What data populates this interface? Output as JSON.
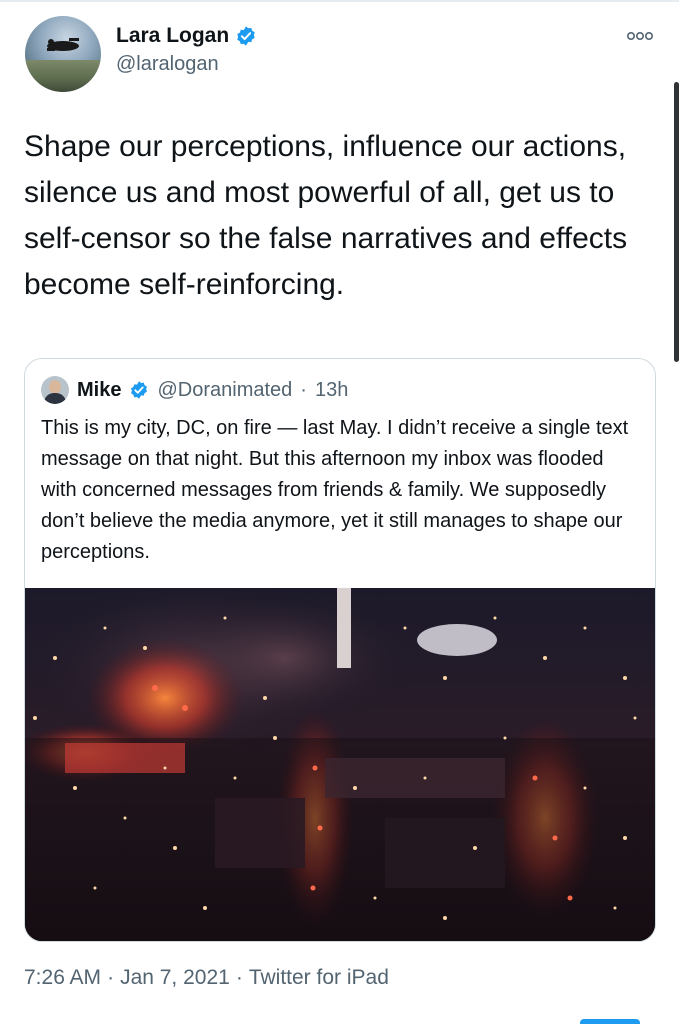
{
  "tweet": {
    "author": {
      "display_name": "Lara Logan",
      "handle": "@laralogan",
      "verified_icon": "verified-badge-icon",
      "avatar_icon": "skydiver-avatar"
    },
    "more_icon": "more-options-icon",
    "text": "Shape our perceptions, influence our actions, silence us and most powerful of all, get us to self-censor so the false narratives and effects become self-reinforcing.",
    "quoted": {
      "display_name": "Mike",
      "handle": "@Doranimated",
      "separator": "·",
      "time": "13h",
      "text": "This is my city, DC, on fire — last May. I didn’t receive a single text message on that night. But this afternoon my inbox was flooded with concerned messages from friends & family. We supposedly don’t believe the media anymore, yet it still manages to shape our perceptions.",
      "image": "aerial-night-photo-dc-fires"
    },
    "meta": {
      "time": "7:26 AM",
      "separator": "·",
      "date": "Jan 7, 2021",
      "separator2": "·",
      "source": "Twitter for iPad"
    }
  },
  "colors": {
    "verified_blue": "#1d9bf0",
    "secondary_text": "#536471",
    "border": "#cfd9de"
  }
}
